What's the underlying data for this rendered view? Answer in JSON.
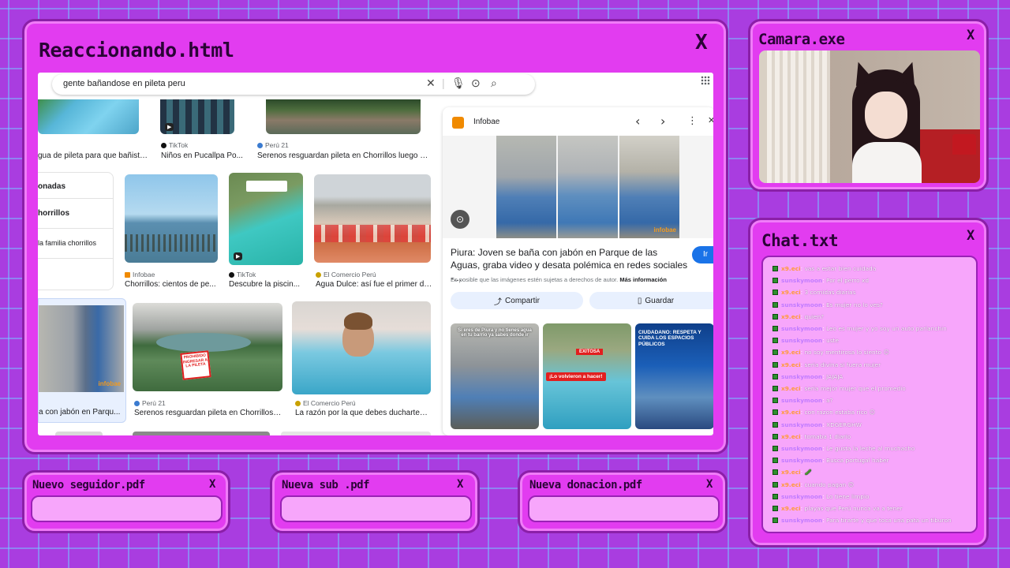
{
  "main_window": {
    "title": "Reaccionando.html"
  },
  "camera_window": {
    "title": "Camara.exe"
  },
  "chat_window": {
    "title": "Chat.txt"
  },
  "alerts": [
    {
      "title": "Nuevo seguidor.pdf"
    },
    {
      "title": "Nueva sub .pdf"
    },
    {
      "title": "Nueva donacion.pdf"
    }
  ],
  "close_glyph": "X",
  "browser": {
    "search_query": "gente bañandose en pileta peru",
    "sidebar_items": [
      "onadas",
      "horrillos",
      "la familia chorrillos"
    ],
    "top_row": [
      {
        "caption": "gua de pileta para que bañista...",
        "source": ""
      },
      {
        "caption": "Niños en Pucallpa Po...",
        "source": "TikTok"
      },
      {
        "caption": "Serenos resguardan pileta en Chorrillos luego de...",
        "source": "Perú 21"
      }
    ],
    "mid_row": [
      {
        "caption": "Chorrillos: cientos de pe...",
        "source": "Infobae"
      },
      {
        "caption": "Descubre la piscin...",
        "source": "TikTok"
      },
      {
        "caption": "Agua Dulce: así fue el primer dí...",
        "source": "El Comercio Perú"
      }
    ],
    "bottom_row": [
      {
        "caption": "a con jabón en Parqu...",
        "source": ""
      },
      {
        "caption": "Serenos resguardan pileta en Chorrillos l...",
        "source": "Perú 21"
      },
      {
        "caption": "La razón por la que debes ducharte a...",
        "source": "El Comercio Perú"
      }
    ],
    "sign_text": "PROHIBIDO INGRESAR A LA PILETA",
    "watermark": "infobae"
  },
  "detail": {
    "source": "Infobae",
    "headline": "Piura: Joven se baña con jabón en Parque de las Aguas, graba video y desata polémica en redes sociales -...",
    "notice": "Es posible que las imágenes estén sujetas a derechos de autor.",
    "more_info": "Más información",
    "go_button": "Ir",
    "share_label": "Compartir",
    "save_label": "Guardar",
    "related": [
      "Si eres de Piura y no tienes agua en tu barrio ya sabes donde ir",
      "¡Lo volvieron a hacer!",
      "CIUDADANO: RESPETA Y CUIDA LOS ESPACIOS PÚBLICOS"
    ],
    "related_brand": "EXITOSA"
  },
  "chat": [
    {
      "user": "x9.eci",
      "msg": "vas a estar bien cuidada",
      "color": "#ff9a3c"
    },
    {
      "user": "sunskymoon",
      "msg": "Por el perro xd",
      "color": "#c27cff"
    },
    {
      "user": "x9.eci",
      "msg": "3 comidas diarias",
      "color": "#ff9a3c"
    },
    {
      "user": "sunskymoon",
      "msg": "Es mujer no lo ves?",
      "color": "#c27cff"
    },
    {
      "user": "x9.eci",
      "msg": "quien?",
      "color": "#ff9a3c"
    },
    {
      "user": "sunskymoon",
      "msg": "Leo es mujer y yo soy un auto parlanchin",
      "color": "#c27cff"
    },
    {
      "user": "sunskymoon",
      "msg": "uste",
      "color": "#c27cff"
    },
    {
      "user": "x9.eci",
      "msg": "no soy mentirosa lo siento 😊",
      "color": "#ff9a3c"
    },
    {
      "user": "x9.eci",
      "msg": "seria divina si fuera mujer",
      "color": "#ff9a3c"
    },
    {
      "user": "sunskymoon",
      "msg": "JAJAJA",
      "color": "#c27cff"
    },
    {
      "user": "x9.eci",
      "msg": "seria mejor mujer que el promedio",
      "color": "#ff9a3c"
    },
    {
      "user": "sunskymoon",
      "msg": "a?",
      "color": "#c27cff"
    },
    {
      "user": "x9.eci",
      "msg": "con razon estaba rico 😊",
      "color": "#ff9a3c"
    },
    {
      "user": "sunskymoon",
      "msg": "XDGERGHW",
      "color": "#c27cff"
    },
    {
      "user": "x9.eci",
      "msg": "tomaba 1 diario",
      "color": "#ff9a3c"
    },
    {
      "user": "sunskymoon",
      "msg": "Le gusta la leche al muchacho",
      "color": "#c27cff"
    },
    {
      "user": "sunskymoon",
      "msg": "Busca portugal haber",
      "color": "#c27cff"
    },
    {
      "user": "x9.eci",
      "msg": "🥒",
      "color": "#ff9a3c"
    },
    {
      "user": "x9.eci",
      "msg": "cuando pagan 😊",
      "color": "#ff9a3c"
    },
    {
      "user": "sunskymoon",
      "msg": "Lo tiene limpio",
      "color": "#c27cff"
    },
    {
      "user": "x9.eci",
      "msg": "playas que Perú nunca va a tener",
      "color": "#ff9a3c"
    },
    {
      "user": "sunskymoon",
      "msg": "Para tirarte y que toca una pata un tiburon",
      "color": "#c27cff"
    }
  ]
}
